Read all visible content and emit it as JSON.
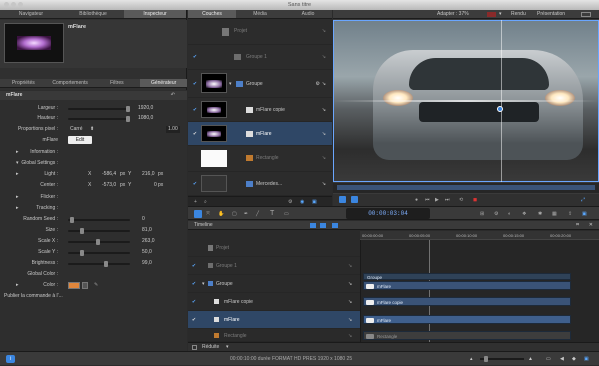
{
  "window": {
    "title": "Sans titre"
  },
  "left_tabs": [
    "Navigateur",
    "Bibliothèque",
    "Inspecteur"
  ],
  "preview": {
    "name": "mFlare"
  },
  "inspector_tabs": [
    "Propriétés",
    "Comportements",
    "Filtres",
    "Générateur"
  ],
  "generator": {
    "section": "mFlare",
    "rows": {
      "largeur": {
        "label": "Largeur :",
        "value": "1920,0"
      },
      "hauteur": {
        "label": "Hauteur :",
        "value": "1080,0"
      },
      "proportions": {
        "label": "Proportions pixel :",
        "value": "Carré",
        "num": "1.00"
      },
      "edit": {
        "label": "mFlare",
        "button": "Edit"
      },
      "information": {
        "label": "Information :"
      },
      "global": {
        "label": "Global Settings :"
      },
      "light": {
        "label": "Light :",
        "x_label": "X",
        "x_value": "-586,4",
        "x_unit": "px",
        "y_label": "Y",
        "y_value": "216,0",
        "y_unit": "px"
      },
      "center": {
        "label": "Center :",
        "x_label": "X",
        "x_value": "-573,0",
        "x_unit": "px",
        "y_label": "Y",
        "y_value": "0",
        "y_unit": "px"
      },
      "flicker": {
        "label": "Flicker :"
      },
      "tracking": {
        "label": "Tracking :"
      },
      "random_seed": {
        "label": "Random Seed :",
        "value": "0"
      },
      "size": {
        "label": "Size :",
        "value": "81,0"
      },
      "scale_x": {
        "label": "Scale X :",
        "value": "263,0"
      },
      "scale_y": {
        "label": "Scale Y :",
        "value": "50,0"
      },
      "brightness": {
        "label": "Brightness :",
        "value": "99,0"
      },
      "global_color": {
        "label": "Global Color :"
      },
      "color": {
        "label": "Color :"
      },
      "publish": {
        "label": "Publier la commande à l'..."
      }
    }
  },
  "layers_tabs": [
    "Couches",
    "Média",
    "Audio"
  ],
  "layers": [
    {
      "name": "Projet"
    },
    {
      "name": "Groupe 1"
    },
    {
      "name": "Groupe"
    },
    {
      "name": "mFlare copie"
    },
    {
      "name": "mFlare"
    },
    {
      "name": "Rectangle"
    },
    {
      "name": "Mercedes..."
    }
  ],
  "viewer": {
    "fit_label": "Adapter : 37%",
    "render_label": "Rendu",
    "presentation_label": "Présentation"
  },
  "transport": {
    "timecode": "00:00:03:04"
  },
  "timeline": {
    "title": "Timeline",
    "ruler": [
      "00:00:00:00",
      "00:00:05:00",
      "00:00:10:00",
      "00:00:15:00",
      "00:00:20:00"
    ],
    "layers": [
      {
        "name": "Projet"
      },
      {
        "name": "Groupe 1"
      },
      {
        "name": "Groupe"
      },
      {
        "name": "mFlare copie"
      },
      {
        "name": "mFlare"
      },
      {
        "name": "Rectangle"
      }
    ],
    "clips": {
      "group": "Groupe",
      "mflare": "mFlare",
      "mflare_copie": "mFlare copie",
      "mflare2": "mFlare",
      "rectangle": "Rectangle"
    },
    "footer_label": "Réduite"
  },
  "status": {
    "text": "00:00:10:00 durée FORMAT HD PRES 1920 x 1080 25"
  },
  "colors": {
    "accent": "#3b86e0",
    "selection": "#2f4766",
    "clip": "#3a5377"
  }
}
